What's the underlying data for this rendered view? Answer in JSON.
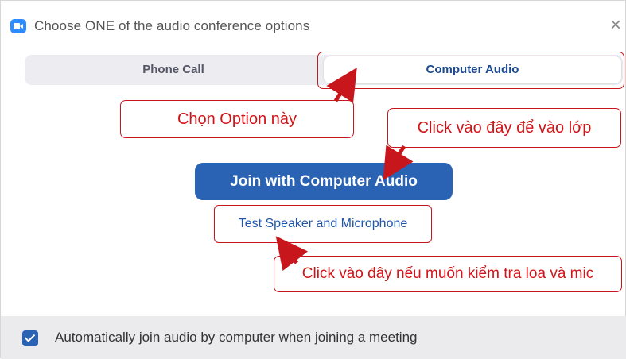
{
  "window": {
    "title": "Choose ONE of the audio conference options",
    "close_symbol": "×",
    "app_icon": "zoom-camera-icon"
  },
  "tabs": [
    {
      "label": "Phone Call",
      "selected": false
    },
    {
      "label": "Computer Audio",
      "selected": true
    }
  ],
  "main": {
    "join_button_label": "Join with Computer Audio",
    "test_link_label": "Test Speaker and Microphone"
  },
  "annotations": {
    "choose_option": "Chọn Option này",
    "click_to_join": "Click vào đây để vào lớp",
    "click_to_test": "Click vào đây nếu muốn kiểm tra loa và mic"
  },
  "footer": {
    "auto_join_label": "Automatically join audio by computer when joining a meeting",
    "auto_join_checked": true
  },
  "colors": {
    "accent": "#2a63b4",
    "annotation": "#d01418",
    "tab_bg": "#ececf1",
    "footer_bg": "#ebebee"
  }
}
